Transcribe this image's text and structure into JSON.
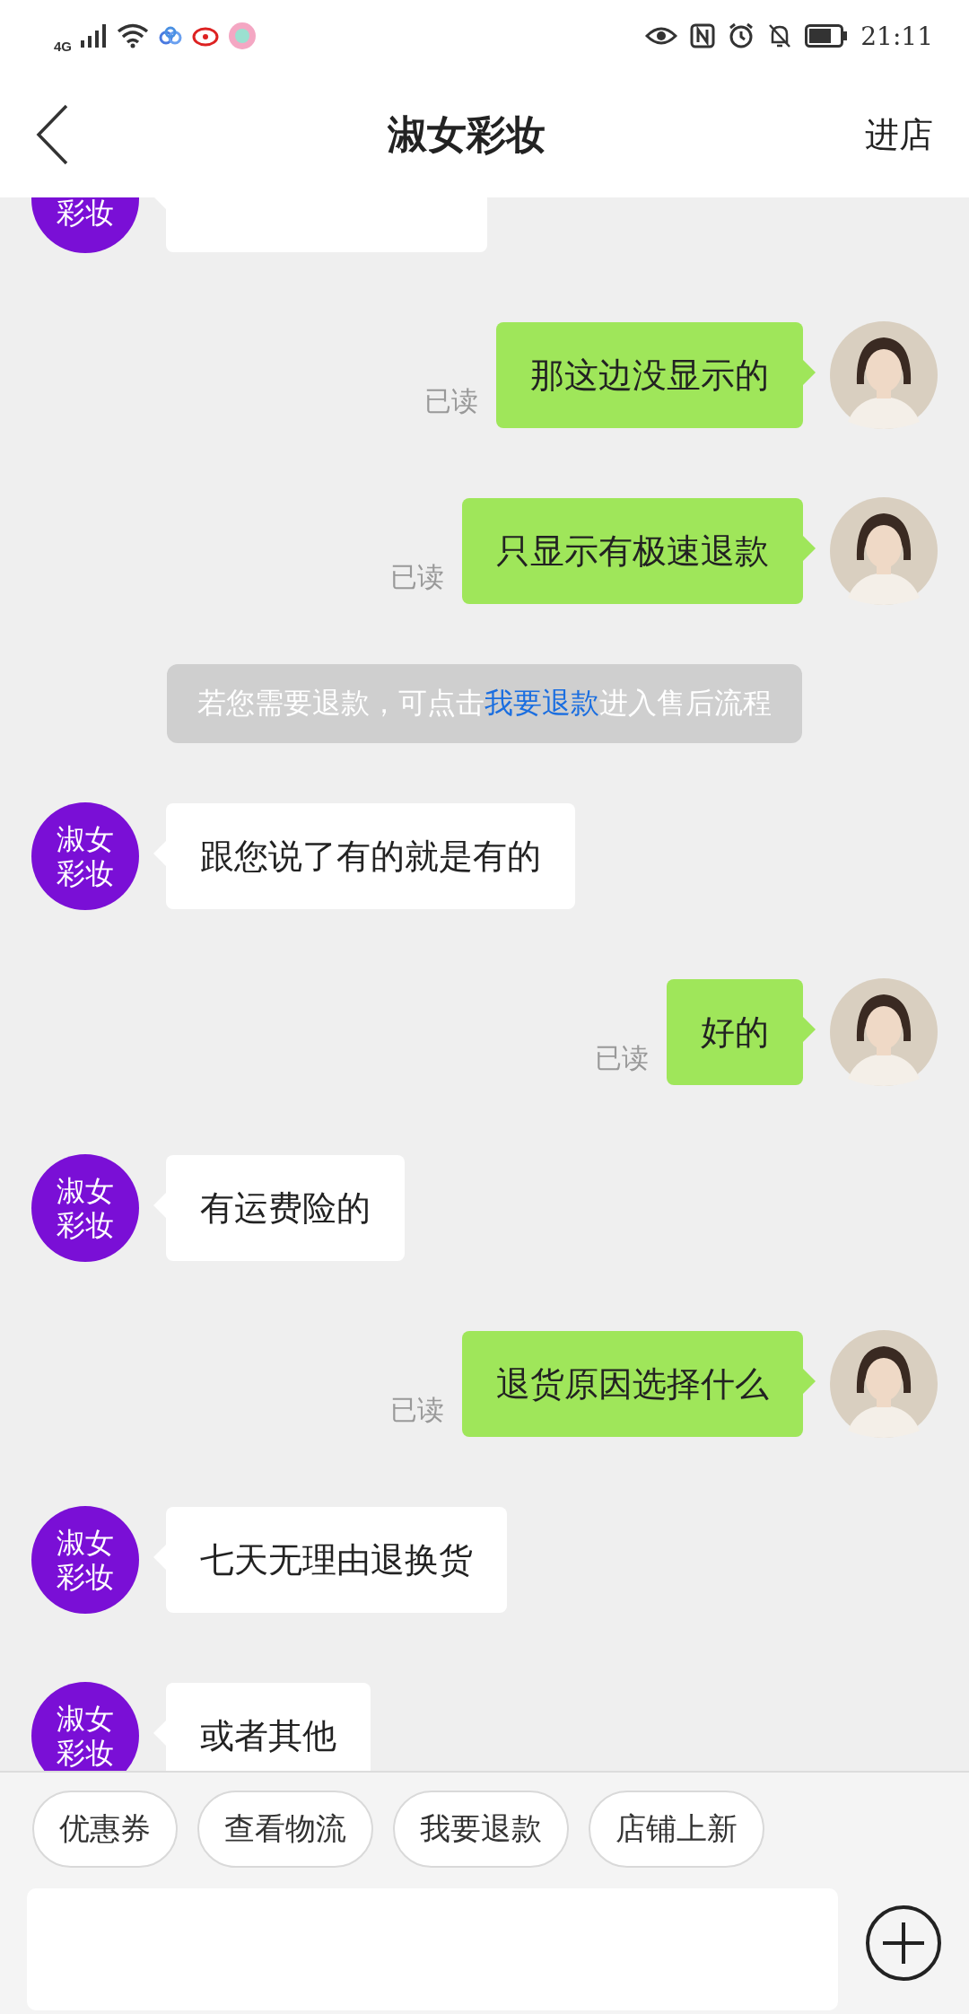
{
  "status_bar": {
    "network": "4G",
    "time": "21:11"
  },
  "header": {
    "title": "淑女彩妆",
    "action": "进店"
  },
  "messages": [
    {
      "kind": "received",
      "avatar_text": "彩妆"
    },
    {
      "kind": "sent",
      "text": "那这边没显示的",
      "read_label": "已读"
    },
    {
      "kind": "sent",
      "text": "只显示有极速退款",
      "read_label": "已读"
    },
    {
      "kind": "notice",
      "text_before": "若您需要退款，可点击",
      "link": "我要退款",
      "text_after": "进入售后流程"
    },
    {
      "kind": "received",
      "avatar_text": "淑女彩妆",
      "text": "跟您说了有的就是有的"
    },
    {
      "kind": "sent",
      "text": "好的",
      "read_label": "已读"
    },
    {
      "kind": "received",
      "avatar_text": "淑女彩妆",
      "text": "有运费险的"
    },
    {
      "kind": "sent",
      "text": "退货原因选择什么",
      "read_label": "已读"
    },
    {
      "kind": "received",
      "avatar_text": "淑女彩妆",
      "text": "七天无理由退换货"
    },
    {
      "kind": "received",
      "avatar_text": "淑女彩妆",
      "text": "或者其他"
    }
  ],
  "quick_replies": [
    "优惠券",
    "查看物流",
    "我要退款",
    "店铺上新"
  ]
}
